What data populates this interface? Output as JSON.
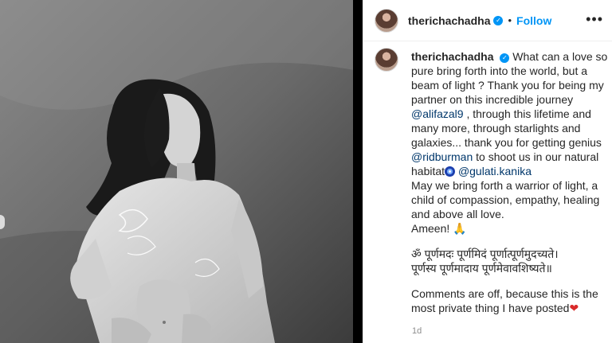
{
  "post": {
    "username": "therichachadha",
    "verified_mark": "✓",
    "separator": "•",
    "follow_label": "Follow",
    "more_label": "•••",
    "time": "1d",
    "image_icon": "photo-of-person"
  },
  "caption": {
    "username": "therichachadha",
    "line1": "What can a love so pure bring forth into the world, but a beam of light ? Thank you for being my partner on this incredible journey",
    "mention1": "@alifazal9",
    "line2": ", through this lifetime and many more, through starlights and galaxies... thank you for getting genius",
    "mention2": "@ridburman",
    "line3": "to shoot us in our natural habitat",
    "mention3": "@gulati.kanika",
    "line4": "May we bring forth a warrior of light, a child of compassion, empathy, healing and above all love.",
    "line5": "Ameen! 🙏",
    "sanskrit1": "ॐ पूर्णमदः पूर्णमिदं पूर्णात्पूर्णमुदच्यते।",
    "sanskrit2": "पूर्णस्य पूर्णमादाय पूर्णमेवावशिष्यते॥",
    "line6": "Comments are off, because this is the most private thing I have posted",
    "heart": "❤"
  },
  "colors": {
    "accent": "#0095f6",
    "mention": "#00376b",
    "heart": "#d92a2a"
  }
}
